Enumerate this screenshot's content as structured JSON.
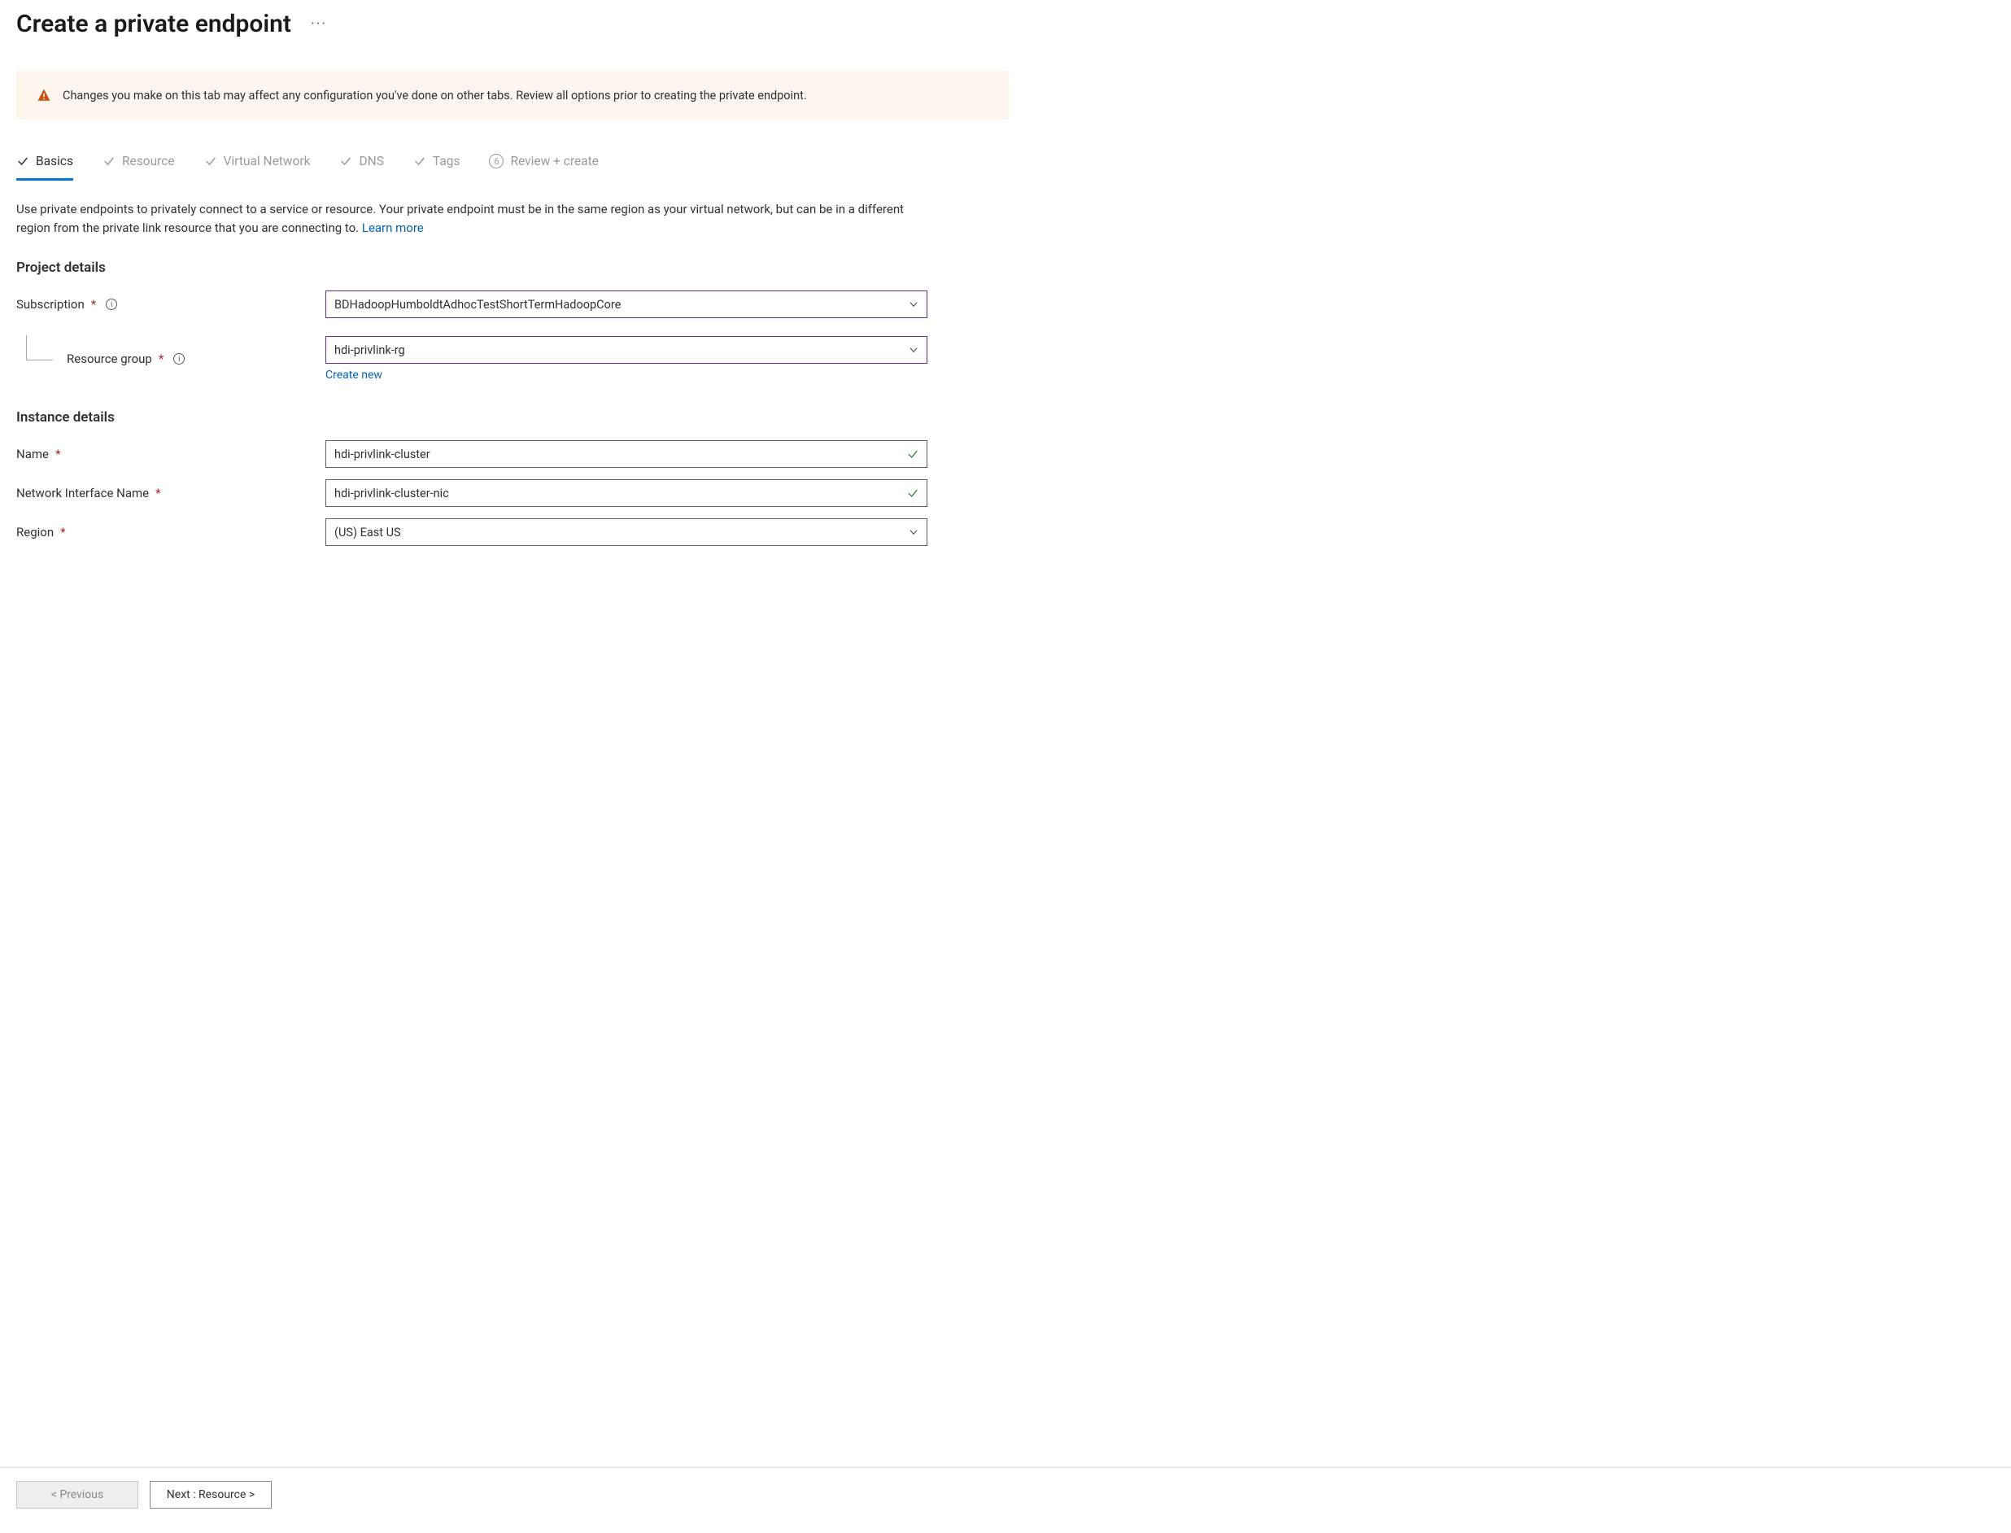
{
  "title": "Create a private endpoint",
  "banner_text": "Changes you make on this tab may affect any configuration you've done on other tabs. Review all options prior to creating the private endpoint.",
  "tabs": {
    "basics": "Basics",
    "resource": "Resource",
    "vnet": "Virtual Network",
    "dns": "DNS",
    "tags": "Tags",
    "review": "Review + create",
    "review_step": "6"
  },
  "intro": {
    "text": "Use private endpoints to privately connect to a service or resource. Your private endpoint must be in the same region as your virtual network, but can be in a different region from the private link resource that you are connecting to.  ",
    "link": "Learn more"
  },
  "sections": {
    "project": "Project details",
    "instance": "Instance details"
  },
  "labels": {
    "subscription": "Subscription",
    "resource_group": "Resource group",
    "create_new": "Create new",
    "name": "Name",
    "nic_name": "Network Interface Name",
    "region": "Region"
  },
  "values": {
    "subscription": "BDHadoopHumboldtAdhocTestShortTermHadoopCore",
    "resource_group": "hdi-privlink-rg",
    "name": "hdi-privlink-cluster",
    "nic_name": "hdi-privlink-cluster-nic",
    "region": "(US) East US"
  },
  "footer": {
    "previous": "< Previous",
    "next": "Next : Resource >"
  }
}
